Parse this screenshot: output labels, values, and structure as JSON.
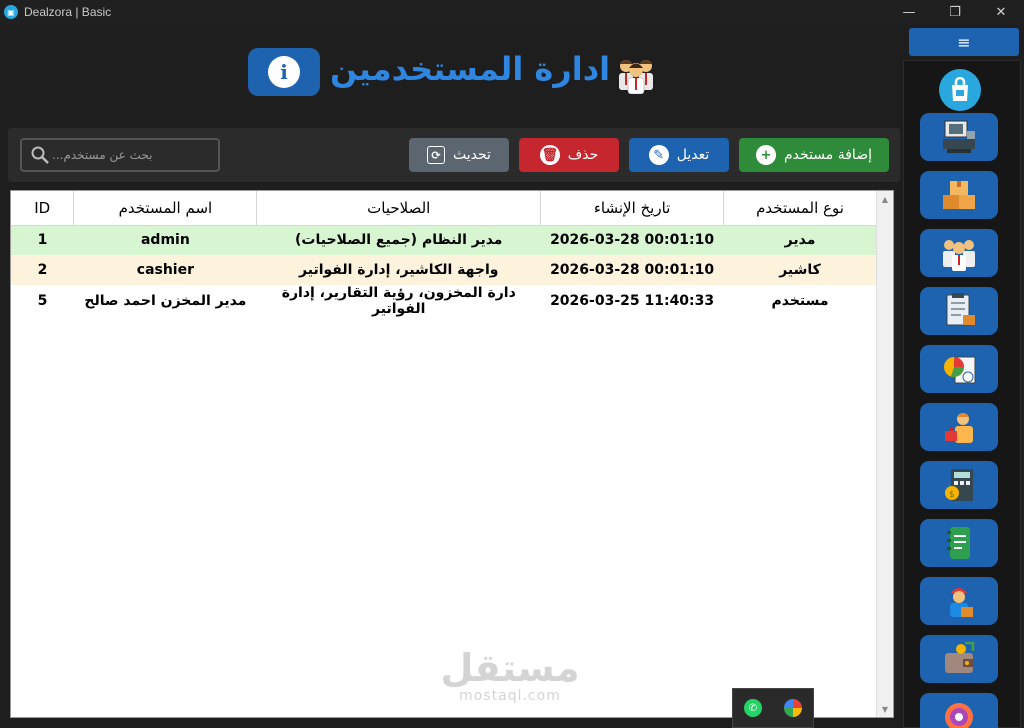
{
  "window": {
    "title": "Dealzora | Basic",
    "controls": [
      "—",
      "❐",
      "✕"
    ]
  },
  "header": {
    "title": "ادارة المستخدمين"
  },
  "toolbar": {
    "search_placeholder": "...بحث عن مستخدم",
    "refresh_label": "تحديث",
    "delete_label": "حذف",
    "edit_label": "تعديل",
    "add_label": "إضافة مستخدم"
  },
  "table": {
    "columns": {
      "id": "ID",
      "username": "اسم المستخدم",
      "permissions": "الصلاحيات",
      "created": "تاريخ الإنشاء",
      "type": "نوع المستخدم"
    },
    "rows": [
      {
        "id": "1",
        "username": "admin",
        "permissions": "مدير النظام (جميع الصلاحيات)",
        "created": "2026-03-28 00:01:10",
        "type": "مدير"
      },
      {
        "id": "2",
        "username": "cashier",
        "permissions": "واجهة الكاشير، إدارة الفواتير",
        "created": "2026-03-28 00:01:10",
        "type": "كاشير"
      },
      {
        "id": "5",
        "username": "مدير المخزن احمد صالح",
        "permissions": "دارة المخزون، رؤية التقارير، إدارة الفواتير",
        "created": "2026-03-25 11:40:33",
        "type": "مستخدم"
      }
    ]
  },
  "watermark": {
    "arabic": "مستقل",
    "latin": "mostaql.com"
  },
  "colors": {
    "accent": "#1d63b0",
    "title": "#2f86e0",
    "add": "#2e8b3a",
    "delete": "#c6262e",
    "refresh": "#5c6670"
  },
  "sidebar": {
    "toggle": "≡",
    "icons": [
      "store-bag-icon",
      "cash-register-icon",
      "boxes-icon",
      "users-group-icon",
      "inventory-report-icon",
      "pie-chart-icon",
      "sales-person-icon",
      "calculator-icon",
      "notes-icon",
      "delivery-worker-icon",
      "wallet-icon",
      "settings-gear-icon"
    ]
  }
}
